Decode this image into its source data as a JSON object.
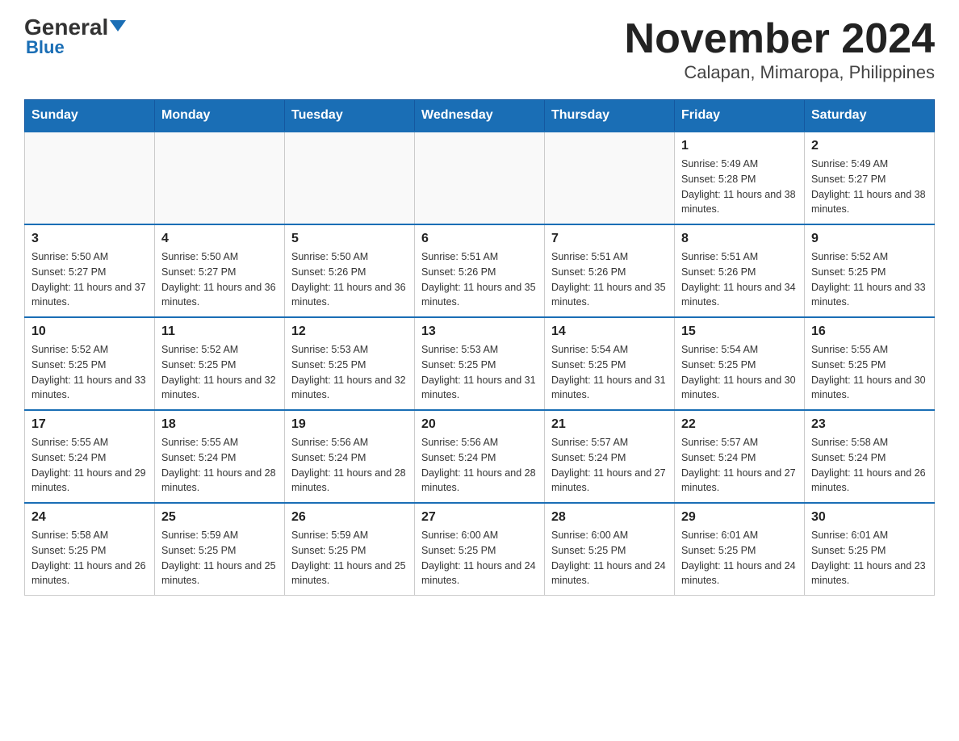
{
  "header": {
    "logo_general": "General",
    "logo_blue": "Blue",
    "title": "November 2024",
    "subtitle": "Calapan, Mimaropa, Philippines"
  },
  "days_of_week": [
    "Sunday",
    "Monday",
    "Tuesday",
    "Wednesday",
    "Thursday",
    "Friday",
    "Saturday"
  ],
  "weeks": [
    [
      {
        "day": "",
        "info": ""
      },
      {
        "day": "",
        "info": ""
      },
      {
        "day": "",
        "info": ""
      },
      {
        "day": "",
        "info": ""
      },
      {
        "day": "",
        "info": ""
      },
      {
        "day": "1",
        "info": "Sunrise: 5:49 AM\nSunset: 5:28 PM\nDaylight: 11 hours and 38 minutes."
      },
      {
        "day": "2",
        "info": "Sunrise: 5:49 AM\nSunset: 5:27 PM\nDaylight: 11 hours and 38 minutes."
      }
    ],
    [
      {
        "day": "3",
        "info": "Sunrise: 5:50 AM\nSunset: 5:27 PM\nDaylight: 11 hours and 37 minutes."
      },
      {
        "day": "4",
        "info": "Sunrise: 5:50 AM\nSunset: 5:27 PM\nDaylight: 11 hours and 36 minutes."
      },
      {
        "day": "5",
        "info": "Sunrise: 5:50 AM\nSunset: 5:26 PM\nDaylight: 11 hours and 36 minutes."
      },
      {
        "day": "6",
        "info": "Sunrise: 5:51 AM\nSunset: 5:26 PM\nDaylight: 11 hours and 35 minutes."
      },
      {
        "day": "7",
        "info": "Sunrise: 5:51 AM\nSunset: 5:26 PM\nDaylight: 11 hours and 35 minutes."
      },
      {
        "day": "8",
        "info": "Sunrise: 5:51 AM\nSunset: 5:26 PM\nDaylight: 11 hours and 34 minutes."
      },
      {
        "day": "9",
        "info": "Sunrise: 5:52 AM\nSunset: 5:25 PM\nDaylight: 11 hours and 33 minutes."
      }
    ],
    [
      {
        "day": "10",
        "info": "Sunrise: 5:52 AM\nSunset: 5:25 PM\nDaylight: 11 hours and 33 minutes."
      },
      {
        "day": "11",
        "info": "Sunrise: 5:52 AM\nSunset: 5:25 PM\nDaylight: 11 hours and 32 minutes."
      },
      {
        "day": "12",
        "info": "Sunrise: 5:53 AM\nSunset: 5:25 PM\nDaylight: 11 hours and 32 minutes."
      },
      {
        "day": "13",
        "info": "Sunrise: 5:53 AM\nSunset: 5:25 PM\nDaylight: 11 hours and 31 minutes."
      },
      {
        "day": "14",
        "info": "Sunrise: 5:54 AM\nSunset: 5:25 PM\nDaylight: 11 hours and 31 minutes."
      },
      {
        "day": "15",
        "info": "Sunrise: 5:54 AM\nSunset: 5:25 PM\nDaylight: 11 hours and 30 minutes."
      },
      {
        "day": "16",
        "info": "Sunrise: 5:55 AM\nSunset: 5:25 PM\nDaylight: 11 hours and 30 minutes."
      }
    ],
    [
      {
        "day": "17",
        "info": "Sunrise: 5:55 AM\nSunset: 5:24 PM\nDaylight: 11 hours and 29 minutes."
      },
      {
        "day": "18",
        "info": "Sunrise: 5:55 AM\nSunset: 5:24 PM\nDaylight: 11 hours and 28 minutes."
      },
      {
        "day": "19",
        "info": "Sunrise: 5:56 AM\nSunset: 5:24 PM\nDaylight: 11 hours and 28 minutes."
      },
      {
        "day": "20",
        "info": "Sunrise: 5:56 AM\nSunset: 5:24 PM\nDaylight: 11 hours and 28 minutes."
      },
      {
        "day": "21",
        "info": "Sunrise: 5:57 AM\nSunset: 5:24 PM\nDaylight: 11 hours and 27 minutes."
      },
      {
        "day": "22",
        "info": "Sunrise: 5:57 AM\nSunset: 5:24 PM\nDaylight: 11 hours and 27 minutes."
      },
      {
        "day": "23",
        "info": "Sunrise: 5:58 AM\nSunset: 5:24 PM\nDaylight: 11 hours and 26 minutes."
      }
    ],
    [
      {
        "day": "24",
        "info": "Sunrise: 5:58 AM\nSunset: 5:25 PM\nDaylight: 11 hours and 26 minutes."
      },
      {
        "day": "25",
        "info": "Sunrise: 5:59 AM\nSunset: 5:25 PM\nDaylight: 11 hours and 25 minutes."
      },
      {
        "day": "26",
        "info": "Sunrise: 5:59 AM\nSunset: 5:25 PM\nDaylight: 11 hours and 25 minutes."
      },
      {
        "day": "27",
        "info": "Sunrise: 6:00 AM\nSunset: 5:25 PM\nDaylight: 11 hours and 24 minutes."
      },
      {
        "day": "28",
        "info": "Sunrise: 6:00 AM\nSunset: 5:25 PM\nDaylight: 11 hours and 24 minutes."
      },
      {
        "day": "29",
        "info": "Sunrise: 6:01 AM\nSunset: 5:25 PM\nDaylight: 11 hours and 24 minutes."
      },
      {
        "day": "30",
        "info": "Sunrise: 6:01 AM\nSunset: 5:25 PM\nDaylight: 11 hours and 23 minutes."
      }
    ]
  ]
}
